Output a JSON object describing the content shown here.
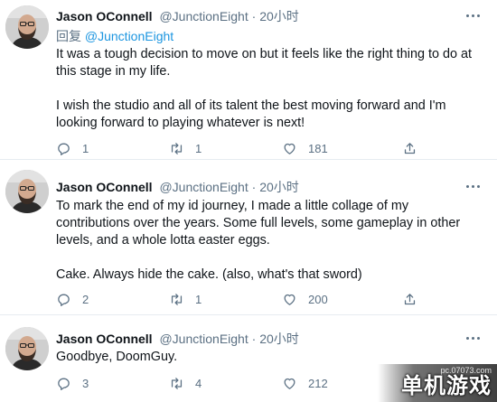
{
  "tweets": [
    {
      "name": "Jason OConnell",
      "handle": "@JunctionEight",
      "separator": "·",
      "time": "20小时",
      "reply_prefix": "回复",
      "reply_to": "@JunctionEight",
      "paragraphs": [
        "It was a tough decision to move on but it feels like the right thing to do at this stage in my life.",
        "I wish the studio and all of its talent the best moving forward and I'm looking forward to playing whatever is next!"
      ],
      "counts": {
        "reply": "1",
        "retweet": "1",
        "like": "181"
      }
    },
    {
      "name": "Jason OConnell",
      "handle": "@JunctionEight",
      "separator": "·",
      "time": "20小时",
      "paragraphs": [
        "To mark the end of my id journey, I made a little collage of my contributions over the years. Some full levels, some gameplay in other levels, and a whole lotta easter eggs.",
        "Cake. Always hide the cake. (also, what's that sword)"
      ],
      "counts": {
        "reply": "2",
        "retweet": "1",
        "like": "200"
      }
    },
    {
      "name": "Jason OConnell",
      "handle": "@JunctionEight",
      "separator": "·",
      "time": "20小时",
      "paragraphs": [
        "Goodbye, DoomGuy."
      ],
      "counts": {
        "reply": "3",
        "retweet": "4",
        "like": "212"
      }
    }
  ],
  "watermark": {
    "url": "pc.07073.com",
    "text": "单机游戏"
  },
  "colors": {
    "text": "#0f1419",
    "muted": "#5b7083",
    "link": "#1b95e0",
    "divider": "#e6ecf0"
  }
}
